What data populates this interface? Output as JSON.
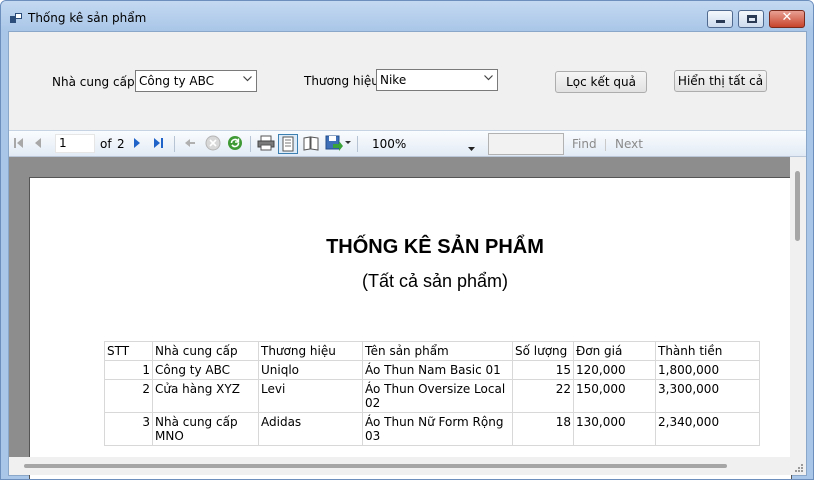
{
  "window": {
    "title": "Thống kê sản phẩm"
  },
  "filters": {
    "supplier_label": "Nhà cung cấp",
    "supplier_value": "Công ty ABC",
    "brand_label": "Thương hiệu",
    "brand_value": "Nike",
    "filter_button": "Lọc kết quả",
    "show_all_button": "Hiển thị tất cả"
  },
  "toolbar": {
    "current_page": "1",
    "of_label": "of",
    "total_pages": "2",
    "zoom": "100%",
    "find_label": "Find",
    "next_label": "Next"
  },
  "report": {
    "title": "THỐNG KÊ SẢN PHẨM",
    "subtitle": "(Tất cả sản phẩm)",
    "columns": [
      "STT",
      "Nhà cung cấp",
      "Thương hiệu",
      "Tên sản phẩm",
      "Số lượng",
      "Đơn giá",
      "Thành tiền"
    ],
    "rows": [
      [
        "1",
        "Công ty ABC",
        "Uniqlo",
        "Áo Thun Nam Basic 01",
        "15",
        "120,000",
        "1,800,000"
      ],
      [
        "2",
        "Cửa hàng XYZ",
        "Levi",
        "Áo Thun Oversize Local 02",
        "22",
        "150,000",
        "3,300,000"
      ],
      [
        "3",
        "Nhà cung cấp MNO",
        "Adidas",
        "Áo Thun Nữ Form Rộng 03",
        "18",
        "130,000",
        "2,340,000"
      ]
    ]
  }
}
